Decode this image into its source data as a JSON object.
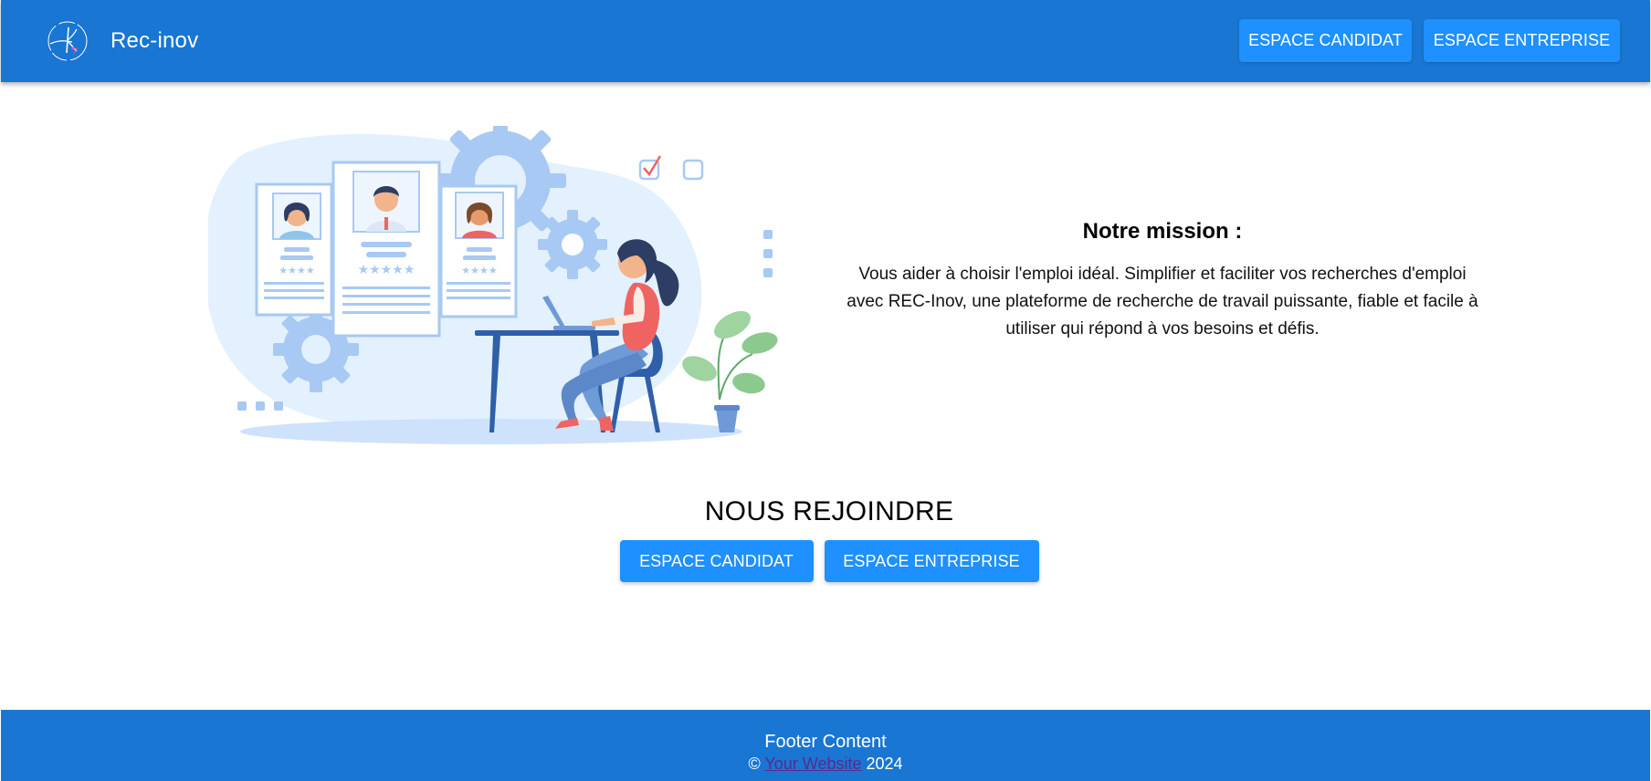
{
  "header": {
    "brand_name": "Rec-inov",
    "nav": {
      "candidate_label": "ESPACE CANDIDAT",
      "company_label": "ESPACE ENTREPRISE"
    }
  },
  "mission": {
    "title": "Notre mission :",
    "text": "Vous aider à choisir l'emploi idéal. Simplifier et faciliter vos recherches d'emploi avec REC-Inov, une plateforme de recherche de travail puissante, fiable et facile à utiliser qui répond à vos besoins et défis."
  },
  "join": {
    "title": "NOUS REJOINDRE",
    "candidate_label": "ESPACE CANDIDAT",
    "company_label": "ESPACE ENTREPRISE"
  },
  "footer": {
    "title": "Footer Content",
    "copyright_symbol": "©",
    "link_text": "Your Website",
    "year": "2024"
  },
  "colors": {
    "primary": "#1976d2",
    "button": "#1e90ff",
    "illustration_light": "#e3f0fd",
    "illustration_mid": "#9ec5f4",
    "accent_red": "#ef6461"
  }
}
